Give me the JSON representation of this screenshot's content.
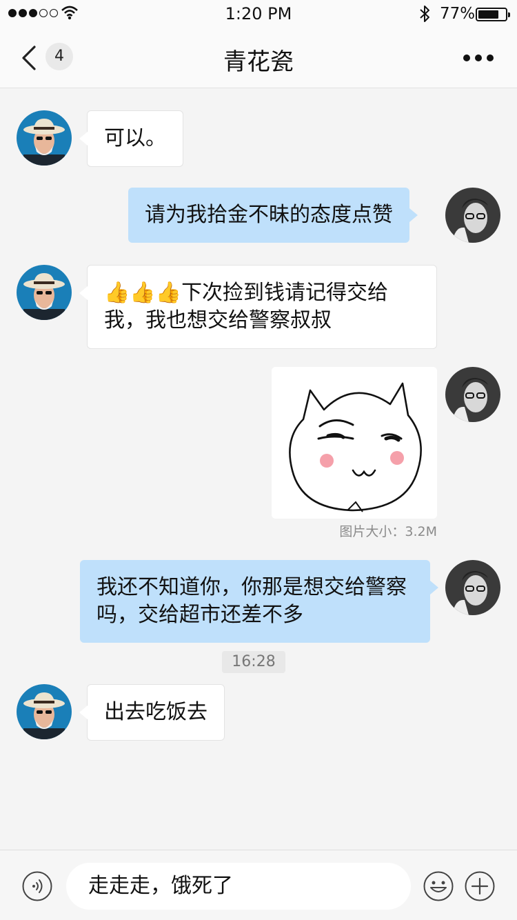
{
  "status_bar": {
    "time": "1:20 PM",
    "battery": "77%",
    "battery_level": 0.77
  },
  "nav": {
    "back_badge": "4",
    "title": "青花瓷"
  },
  "messages": [
    {
      "side": "in",
      "text": "可以。"
    },
    {
      "side": "out",
      "text": "请为我拾金不昧的态度点赞"
    },
    {
      "side": "in",
      "emoji": "👍👍👍",
      "text": "下次捡到钱请记得交给我，我也想交给警察叔叔"
    },
    {
      "side": "out",
      "type": "image",
      "caption": "图片大小：3.2M"
    },
    {
      "side": "out",
      "text": "我还不知道你，你那是想交给警察吗，交给超市还差不多"
    },
    {
      "type": "time",
      "text": "16:28"
    },
    {
      "side": "in",
      "text": "出去吃饭去"
    }
  ],
  "input": {
    "value": "走走走，饿死了"
  },
  "icons": {
    "back": "chevron-left-icon",
    "more": "more-dots-icon",
    "voice": "voice-icon",
    "emoji": "smiley-icon",
    "plus": "plus-icon",
    "wifi": "wifi-icon",
    "bluetooth": "bluetooth-icon"
  },
  "colors": {
    "outgoing_bubble": "#bfe0fb",
    "incoming_bubble": "#ffffff",
    "background": "#f4f4f4"
  }
}
